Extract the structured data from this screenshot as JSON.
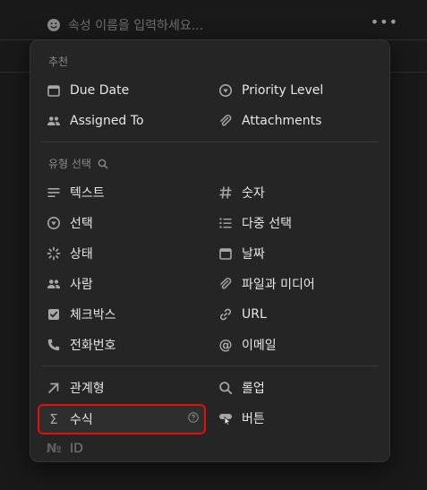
{
  "property": {
    "placeholder": "속성 이름을 입력하세요..."
  },
  "menu": {
    "suggested": {
      "title": "추천",
      "items": [
        "Due Date",
        "Priority Level",
        "Assigned To",
        "Attachments"
      ]
    },
    "types": {
      "title": "유형 선택",
      "items": [
        "텍스트",
        "숫자",
        "선택",
        "다중 선택",
        "상태",
        "날짜",
        "사람",
        "파일과 미디어",
        "체크박스",
        "URL",
        "전화번호",
        "이메일"
      ]
    },
    "advanced": {
      "items": [
        "관계형",
        "롤업",
        "수식",
        "버튼",
        "ID"
      ]
    }
  },
  "colors": {
    "background": "#191919",
    "menu_bg": "#252525",
    "highlight_border": "#e01010"
  }
}
